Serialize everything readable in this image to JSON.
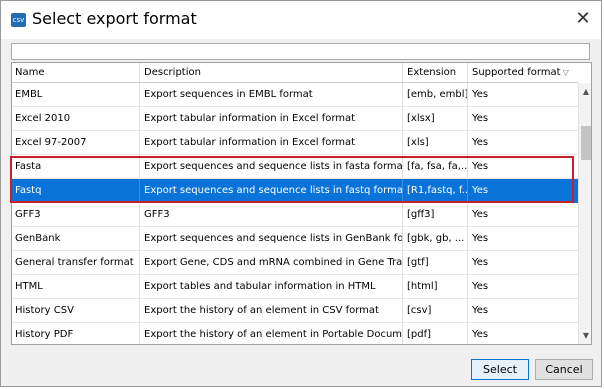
{
  "dialog": {
    "icon_text": "csv",
    "title": "Select export format",
    "close_glyph": "✕"
  },
  "filter": {
    "value": "",
    "placeholder": ""
  },
  "table": {
    "columns": [
      "Name",
      "Description",
      "Extension",
      "Supported format"
    ],
    "sort_glyph": "▽",
    "rows": [
      {
        "name": "EMBL",
        "description": "Export sequences in EMBL format",
        "extension": "[emb, embl]",
        "supported": "Yes"
      },
      {
        "name": "Excel 2010",
        "description": "Export tabular information in Excel format",
        "extension": "[xlsx]",
        "supported": "Yes"
      },
      {
        "name": "Excel 97-2007",
        "description": "Export tabular information in Excel format",
        "extension": "[xls]",
        "supported": "Yes"
      },
      {
        "name": "Fasta",
        "description": "Export sequences and sequence lists in fasta format",
        "extension": "[fa, fsa, fa,...",
        "supported": "Yes"
      },
      {
        "name": "Fastq",
        "description": "Export sequences and sequence lists in fastq format",
        "extension": "[R1,fastq, f...",
        "supported": "Yes"
      },
      {
        "name": "GFF3",
        "description": "GFF3",
        "extension": "[gff3]",
        "supported": "Yes"
      },
      {
        "name": "GenBank",
        "description": "Export sequences and sequence lists in GenBank for...",
        "extension": "[gbk, gb, ...",
        "supported": "Yes"
      },
      {
        "name": "General transfer format",
        "description": "Export Gene, CDS and mRNA combined in Gene Tra...",
        "extension": "[gtf]",
        "supported": "Yes"
      },
      {
        "name": "HTML",
        "description": "Export tables and tabular information in HTML",
        "extension": "[html]",
        "supported": "Yes"
      },
      {
        "name": "History CSV",
        "description": "Export the history of an element in CSV format",
        "extension": "[csv]",
        "supported": "Yes"
      },
      {
        "name": "History PDF",
        "description": "Export the history of an element in Portable Document...",
        "extension": "[pdf]",
        "supported": "Yes"
      }
    ],
    "selected_row": "Fastq"
  },
  "scrollbar": {
    "up_glyph": "▲",
    "down_glyph": "▼"
  },
  "buttons": {
    "select": "Select",
    "cancel": "Cancel"
  }
}
